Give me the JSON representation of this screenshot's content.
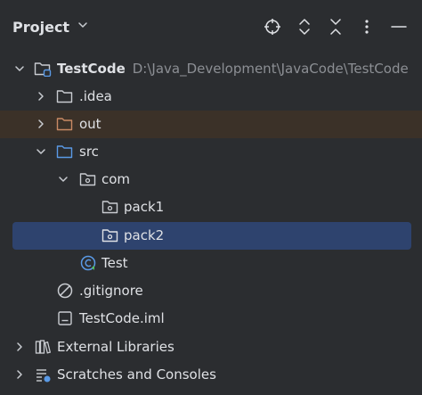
{
  "header": {
    "title": "Project",
    "title_dropdown_icon": "chevron-down-icon",
    "icons": [
      "locate-target-icon",
      "expand-all-icon",
      "collapse-all-icon",
      "more-options-icon",
      "minimize-icon"
    ]
  },
  "tree": {
    "root": {
      "label": "TestCode",
      "path": "D:\\Java_Development\\JavaCode\\TestCode",
      "icon": "module-folder-icon"
    },
    "idea": {
      "label": ".idea",
      "icon": "folder-icon"
    },
    "out": {
      "label": "out",
      "icon": "excluded-folder-icon"
    },
    "src": {
      "label": "src",
      "icon": "source-folder-icon"
    },
    "com": {
      "label": "com",
      "icon": "package-icon"
    },
    "pack1": {
      "label": "pack1",
      "icon": "package-icon"
    },
    "pack2": {
      "label": "pack2",
      "icon": "package-icon"
    },
    "test": {
      "label": "Test",
      "icon": "java-class-icon"
    },
    "gitignore": {
      "label": ".gitignore",
      "icon": "ignored-file-icon"
    },
    "iml": {
      "label": "TestCode.iml",
      "icon": "module-file-icon"
    },
    "ext_libs": {
      "label": "External Libraries",
      "icon": "libraries-icon"
    },
    "scratches": {
      "label": "Scratches and Consoles",
      "icon": "scratches-icon"
    }
  },
  "colors": {
    "background": "#2b2d30",
    "selection": "#2e436e",
    "excluded_row": "#3b3128",
    "excluded_folder": "#c98a64",
    "source_folder": "#5a9ae6",
    "path_text": "#8c8f94"
  }
}
